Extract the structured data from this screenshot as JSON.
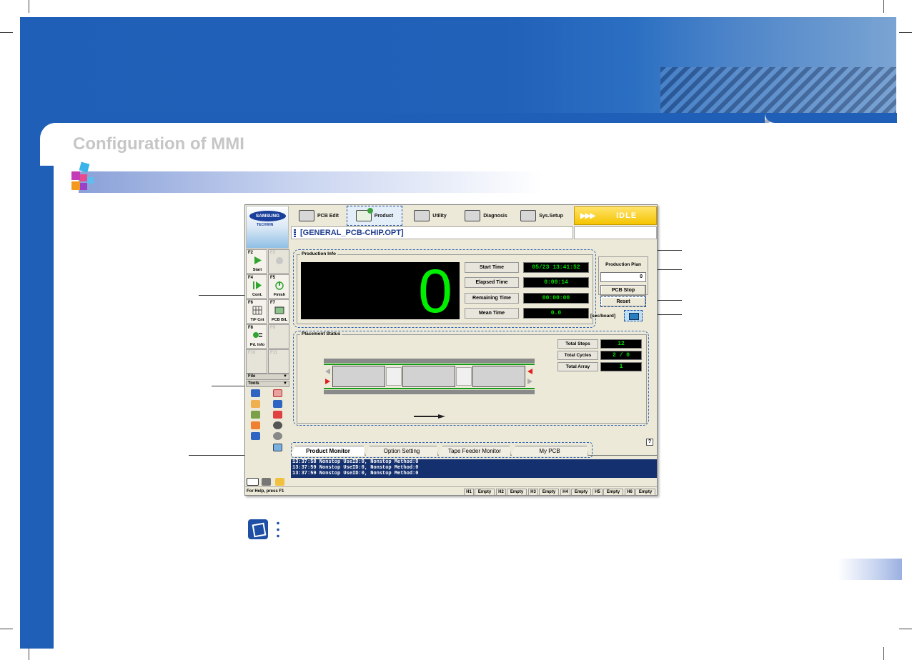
{
  "page": {
    "title": "Configuration of MMI"
  },
  "app": {
    "logo": {
      "brand": "SAMSUNG",
      "sub": "TECHWIN"
    },
    "menu": [
      {
        "label": "PCB Edit",
        "icon": "pcb-edit-icon"
      },
      {
        "label": "Product",
        "icon": "product-icon",
        "active": true
      },
      {
        "label": "Utility",
        "icon": "utility-icon"
      },
      {
        "label": "Diagnosis",
        "icon": "diagnosis-icon"
      },
      {
        "label": "Sys.Setup",
        "icon": "sys-setup-icon"
      }
    ],
    "status": {
      "label": "IDLE",
      "arrows": "▶▶▶",
      "color": "#f5c400"
    },
    "filename": "[GENERAL_PCB-CHIP.OPT]",
    "fkeys": [
      {
        "key": "F2",
        "label": "Start",
        "icon": "play-icon"
      },
      {
        "key": "F3",
        "label": "",
        "icon": "hand-icon",
        "disabled": true
      },
      {
        "key": "F4",
        "label": "Cont.",
        "icon": "continue-icon"
      },
      {
        "key": "F5",
        "label": "Finish",
        "icon": "finish-icon"
      },
      {
        "key": "F6",
        "label": "T/F Cnt",
        "icon": "tf-count-icon"
      },
      {
        "key": "F7",
        "label": "PCB B/L",
        "icon": "pcb-bl-icon"
      },
      {
        "key": "F8",
        "label": "Pd. Info",
        "icon": "pd-info-icon"
      },
      {
        "key": "F9",
        "label": "",
        "disabled": true
      },
      {
        "key": "F10",
        "label": "",
        "disabled": true
      },
      {
        "key": "F11",
        "label": "",
        "disabled": true
      }
    ],
    "side_panels": {
      "file": "File",
      "tools": "Tools"
    },
    "production_info": {
      "title": "Production Info",
      "count": "0",
      "rows": [
        {
          "label": "Start Time",
          "value": "05/23 13:41:52"
        },
        {
          "label": "Elapsed Time",
          "value": "0:00:14"
        },
        {
          "label": "Remaining Time",
          "value": "00:00:00"
        },
        {
          "label": "Mean Time",
          "value": "0.0"
        }
      ]
    },
    "production_plan": {
      "label": "Production Plan",
      "value": "0",
      "pcb_stop": "PCB Stop",
      "reset": "Reset",
      "unit": "[sec/board]"
    },
    "placement_status": {
      "title": "Placement Status",
      "totals": [
        {
          "label": "Total Steps",
          "value": "12"
        },
        {
          "label": "Total Cycles",
          "value": "2 / 0"
        },
        {
          "label": "Total Array",
          "value": "1"
        }
      ]
    },
    "help": "?",
    "tabs": [
      "Product Monitor",
      "Option Setting",
      "Tape Feeder Monitor",
      "My PCB"
    ],
    "log": [
      "13:37:58  Nonstop UseID:0, Nonstop Method:0",
      "13:37:59  Nonstop UseID:0, Nonstop Method:0",
      "13:37:59  Nonstop UseID:0, Nonstop Method:0"
    ],
    "statusbar": {
      "help": "For Help, press F1",
      "heads": [
        {
          "head": "H1",
          "state": "Empty"
        },
        {
          "head": "H2",
          "state": "Empty"
        },
        {
          "head": "H3",
          "state": "Empty"
        },
        {
          "head": "H4",
          "state": "Empty"
        },
        {
          "head": "H5",
          "state": "Empty"
        },
        {
          "head": "H6",
          "state": "Empty"
        }
      ]
    }
  }
}
